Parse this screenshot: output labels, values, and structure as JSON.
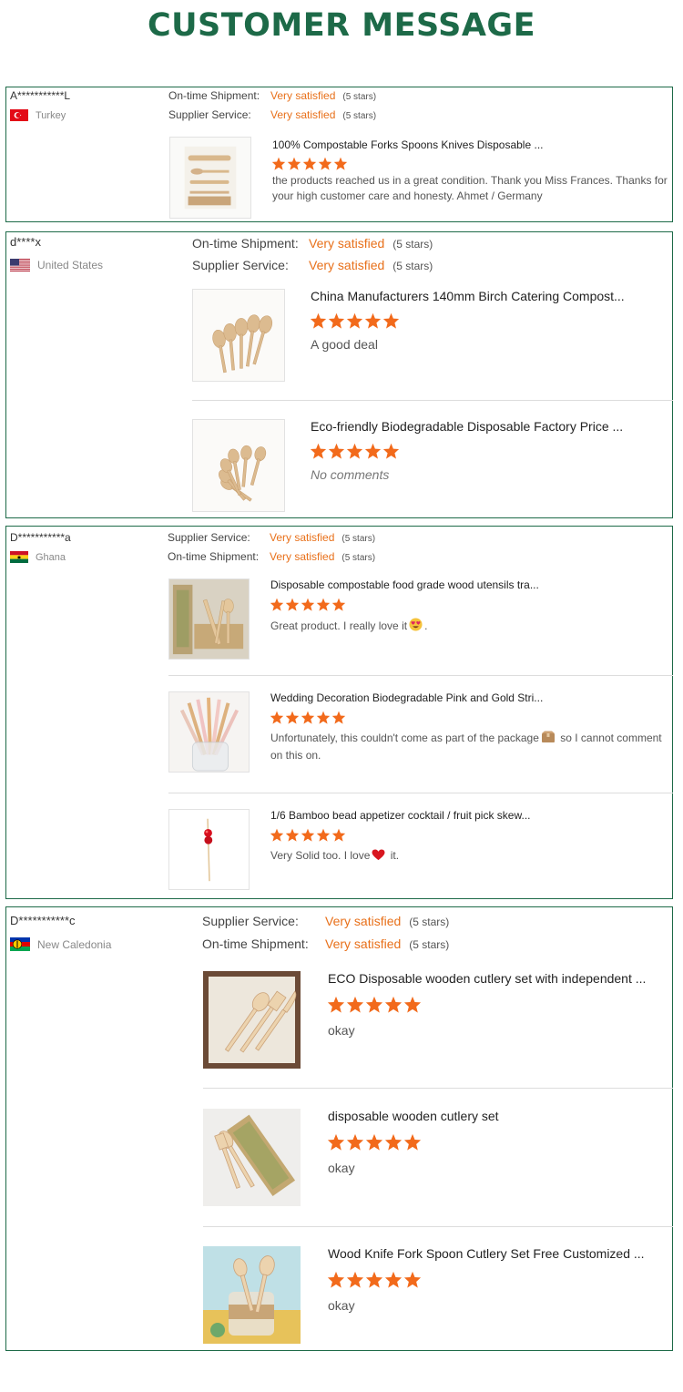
{
  "title": "CUSTOMER MESSAGE",
  "colors": {
    "accent": "#1d6a48",
    "rating": "#e8701a",
    "star": "#f26a1b"
  },
  "reviews": [
    {
      "buyer": "A***********L",
      "country": "Turkey",
      "flag_icon": "turkey-flag-icon",
      "ratings": [
        {
          "label": "On-time Shipment:",
          "value": "Very satisfied",
          "stars_text": "(5 stars)"
        },
        {
          "label": "Supplier Service:",
          "value": "Very satisfied",
          "stars_text": "(5 stars)"
        }
      ],
      "products": [
        {
          "title": "100% Compostable Forks Spoons Knives Disposable ...",
          "stars": 5,
          "comment": "the products reached us in a great condition. Thank you Miss Frances. Thanks for your high customer care and honesty. Ahmet / Germany",
          "image_icon": "wooden-cutlery-pack-image"
        }
      ]
    },
    {
      "buyer": "d****x",
      "country": "United States",
      "flag_icon": "usa-flag-icon",
      "ratings": [
        {
          "label": "On-time Shipment:",
          "value": "Very satisfied",
          "stars_text": "(5 stars)"
        },
        {
          "label": "Supplier Service:",
          "value": "Very satisfied",
          "stars_text": "(5 stars)"
        }
      ],
      "products": [
        {
          "title": "China Manufacturers 140mm Birch Catering Compost...",
          "stars": 5,
          "comment": "A good deal",
          "image_icon": "wooden-spoons-fan-image"
        },
        {
          "title": "Eco-friendly Biodegradable Disposable Factory Price ...",
          "stars": 5,
          "comment": "No comments",
          "empty": true,
          "image_icon": "wooden-spoons-pile-image"
        }
      ]
    },
    {
      "buyer": "D***********a",
      "country": "Ghana",
      "flag_icon": "ghana-flag-icon",
      "ratings": [
        {
          "label": "Supplier Service:",
          "value": "Very satisfied",
          "stars_text": "(5 stars)"
        },
        {
          "label": "On-time Shipment:",
          "value": "Very satisfied",
          "stars_text": "(5 stars)"
        }
      ],
      "products": [
        {
          "title": "Disposable compostable food grade wood utensils tra...",
          "stars": 5,
          "comment": "Great product. I really love it",
          "comment_after": ".",
          "emoji_icon": "heart-eyes-emoji-icon",
          "image_icon": "wooden-utensils-kraft-image"
        },
        {
          "title": "Wedding Decoration Biodegradable Pink and Gold Stri...",
          "stars": 5,
          "comment": "Unfortunately, this couldn't come as part of the package",
          "comment_after": " so I cannot comment on this on.",
          "emoji_icon": "package-emoji-icon",
          "image_icon": "paper-straws-jar-image"
        },
        {
          "title": "1/6 Bamboo bead appetizer cocktail / fruit pick skew...",
          "stars": 5,
          "comment": "Very Solid too. I love",
          "comment_after": " it.",
          "emoji_icon": "red-heart-emoji-icon",
          "image_icon": "bamboo-pick-image"
        }
      ]
    },
    {
      "buyer": "D***********c",
      "country": "New Caledonia",
      "flag_icon": "new-caledonia-flag-icon",
      "ratings": [
        {
          "label": "Supplier Service:",
          "value": "Very satisfied",
          "stars_text": "(5 stars)"
        },
        {
          "label": "On-time Shipment:",
          "value": "Very satisfied",
          "stars_text": "(5 stars)"
        }
      ],
      "products": [
        {
          "title": "ECO Disposable wooden cutlery set with independent ...",
          "stars": 5,
          "comment": "okay",
          "image_icon": "wooden-cutlery-set-image"
        },
        {
          "title": "disposable wooden cutlery set",
          "stars": 5,
          "comment": "okay",
          "image_icon": "wooden-cutlery-kraft-image"
        },
        {
          "title": "Wood Knife Fork Spoon Cutlery Set Free Customized ...",
          "stars": 5,
          "comment": "okay",
          "image_icon": "wooden-cutlery-jar-image"
        }
      ]
    }
  ]
}
